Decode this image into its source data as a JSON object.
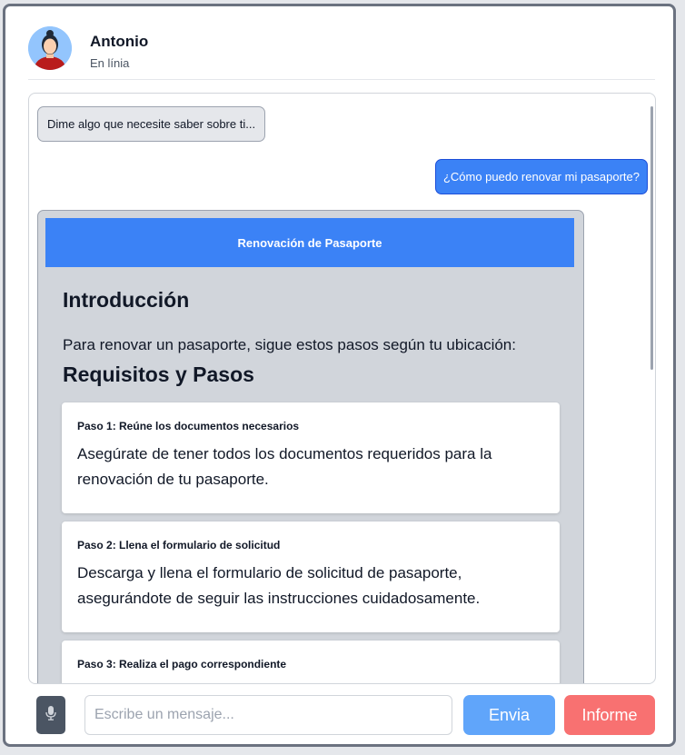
{
  "header": {
    "name": "Antonio",
    "status": "En línia"
  },
  "messages": [
    {
      "role": "bot",
      "text": "Dime algo que necesite saber sobre ti..."
    },
    {
      "role": "user",
      "text": "¿Cómo puedo renovar mi pasaporte?"
    }
  ],
  "card": {
    "title": "Renovación de Pasaporte",
    "intro_heading": "Introducción",
    "intro_text": "Para renovar un pasaporte, sigue estos pasos según tu ubicación:",
    "requirements_heading": "Requisitos y Pasos",
    "steps": [
      {
        "title": "Paso 1: Reúne los documentos necesarios",
        "text": "Asegúrate de tener todos los documentos requeridos para la renovación de tu pasaporte."
      },
      {
        "title": "Paso 2: Llena el formulario de solicitud",
        "text": "Descarga y llena el formulario de solicitud de pasaporte, asegurándote de seguir las instrucciones cuidadosamente."
      },
      {
        "title": "Paso 3: Realiza el pago correspondiente",
        "text": ""
      }
    ]
  },
  "composer": {
    "placeholder": "Escribe un mensaje...",
    "send_label": "Envia",
    "report_label": "Informe",
    "mic_icon": "microphone-icon"
  },
  "colors": {
    "accent": "#3b82f6",
    "send": "#60a5fa",
    "report": "#f87171"
  }
}
